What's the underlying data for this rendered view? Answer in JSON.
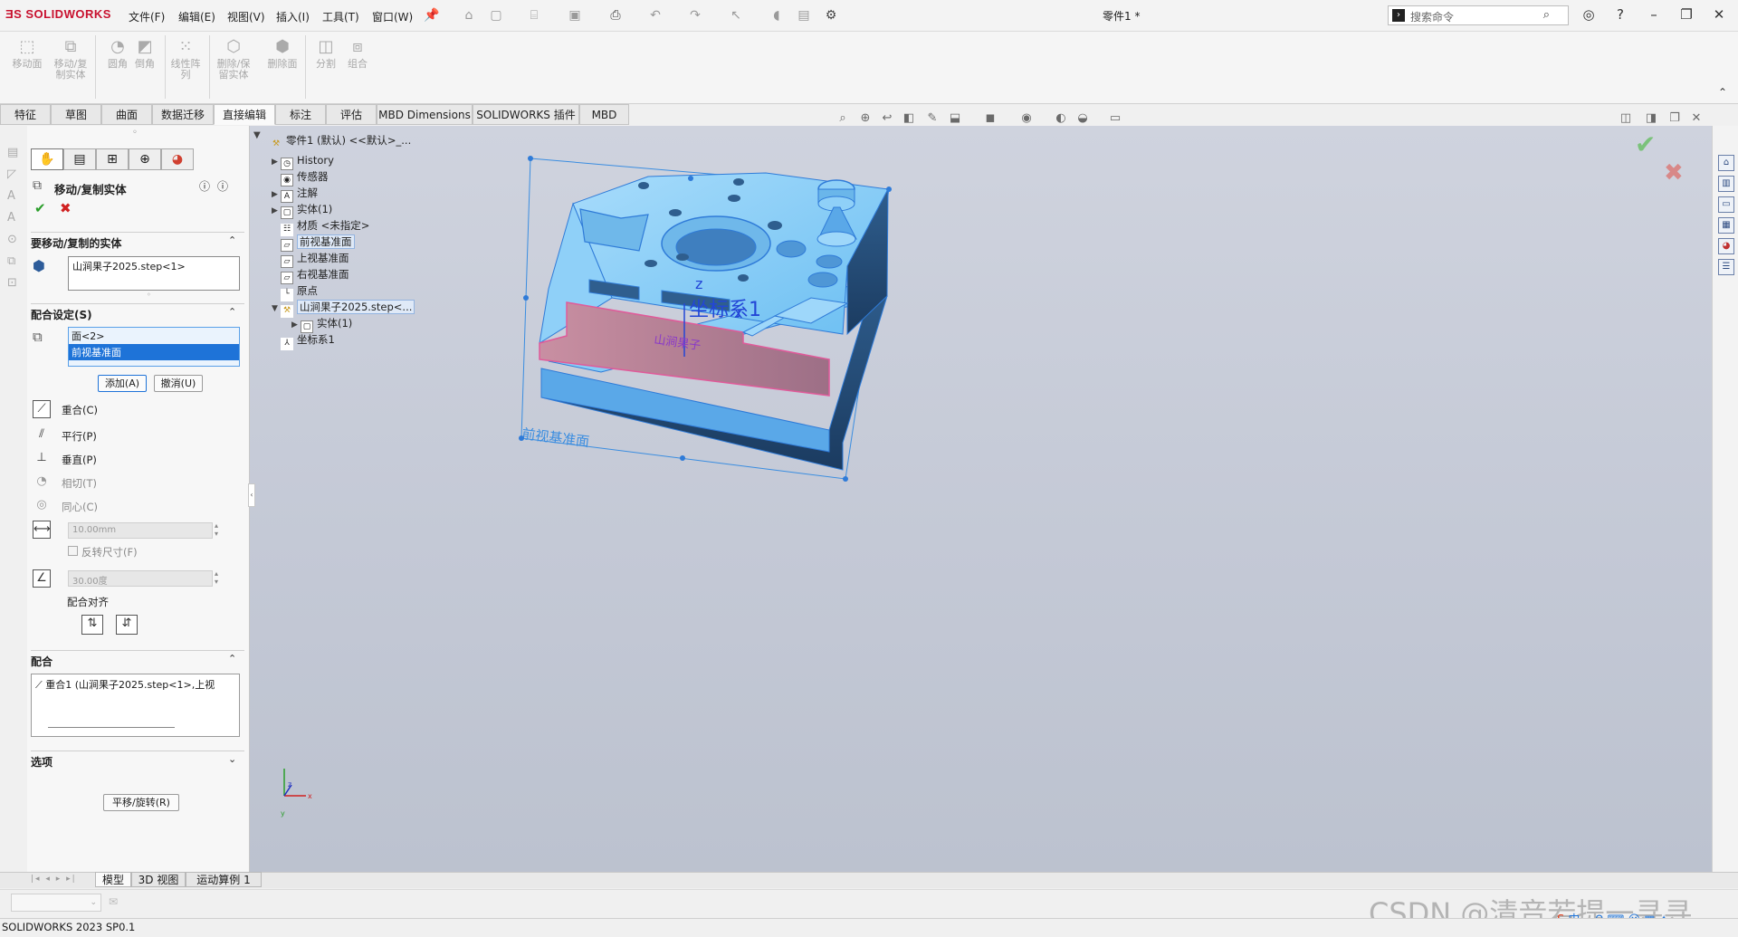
{
  "app": {
    "logo": "SOLIDWORKS",
    "document_title": "零件1 *",
    "version": "SOLIDWORKS 2023 SP0.1"
  },
  "menu": [
    "文件(F)",
    "编辑(E)",
    "视图(V)",
    "插入(I)",
    "工具(T)",
    "窗口(W)"
  ],
  "search": {
    "placeholder": "搜索命令"
  },
  "commands": [
    {
      "label": "移动面",
      "icon": "move-face-icon"
    },
    {
      "label": "移动/复制实体",
      "icon": "move-copy-body-icon"
    },
    {
      "label": "圆角",
      "icon": "fillet-icon"
    },
    {
      "label": "倒角",
      "icon": "chamfer-icon"
    },
    {
      "label": "线性阵列",
      "icon": "linear-pattern-icon"
    },
    {
      "label": "删除/保留实体",
      "icon": "delete-body-icon"
    },
    {
      "label": "删除面",
      "icon": "delete-face-icon"
    },
    {
      "label": "分割",
      "icon": "split-icon"
    },
    {
      "label": "组合",
      "icon": "combine-icon"
    }
  ],
  "tabs": [
    "特征",
    "草图",
    "曲面",
    "数据迁移",
    "直接编辑",
    "标注",
    "评估",
    "MBD Dimensions",
    "SOLIDWORKS 插件",
    "MBD"
  ],
  "active_tab": "直接编辑",
  "property_manager": {
    "title": "移动/复制实体",
    "section_bodies": "要移动/复制的实体",
    "body_item": "山涧果子2025.step<1>",
    "section_mate": "配合设定(S)",
    "mate_entities": [
      "面<2>",
      "前视基准面"
    ],
    "add_button": "添加(A)",
    "undo_button": "撤消(U)",
    "mate_types": [
      {
        "label": "重合(C)",
        "icon": "coincident-icon"
      },
      {
        "label": "平行(P)",
        "icon": "parallel-icon"
      },
      {
        "label": "垂直(P)",
        "icon": "perpendicular-icon"
      },
      {
        "label": "相切(T)",
        "icon": "tangent-icon"
      },
      {
        "label": "同心(C)",
        "icon": "concentric-icon"
      }
    ],
    "distance_value": "10.00mm",
    "flip_dimension": "反转尺寸(F)",
    "angle_value": "30.00度",
    "mate_alignment": "配合对齐",
    "section_mates": "配合",
    "mate_list_item": "重合1 (山涧果子2025.step<1>,上视",
    "section_options": "选项",
    "translate_rotate_button": "平移/旋转(R)"
  },
  "feature_tree": {
    "root": "零件1 (默认) <<默认>_...",
    "items": [
      {
        "label": "History",
        "icon": "history-icon"
      },
      {
        "label": "传感器",
        "icon": "sensor-icon"
      },
      {
        "label": "注解",
        "icon": "annotation-icon"
      },
      {
        "label": "实体(1)",
        "icon": "solid-bodies-icon"
      },
      {
        "label": "材质 <未指定>",
        "icon": "material-icon"
      },
      {
        "label": "前视基准面",
        "icon": "plane-icon"
      },
      {
        "label": "上视基准面",
        "icon": "plane-icon"
      },
      {
        "label": "右视基准面",
        "icon": "plane-icon"
      },
      {
        "label": "原点",
        "icon": "origin-icon"
      },
      {
        "label": "山涧果子2025.step<...",
        "icon": "imported-body-icon"
      },
      {
        "label": "实体(1)",
        "icon": "solid-bodies-icon"
      },
      {
        "label": "坐标系1",
        "icon": "coordinate-system-icon"
      }
    ]
  },
  "viewport": {
    "plane_label": "前视基准面",
    "coord_label": "坐标系1",
    "engraved_text": "山涧果子",
    "triad": {
      "x": "x",
      "y": "y",
      "z": "z"
    },
    "colors": {
      "body": "#7ec8f5",
      "edge": "#2f7bd8",
      "highlight_face": "#d98fa8",
      "background": "#c8ccd8"
    }
  },
  "bottom_tabs": [
    "模型",
    "3D 视图",
    "运动算例 1"
  ],
  "watermark": "CSDN @清音若提一寻寻"
}
